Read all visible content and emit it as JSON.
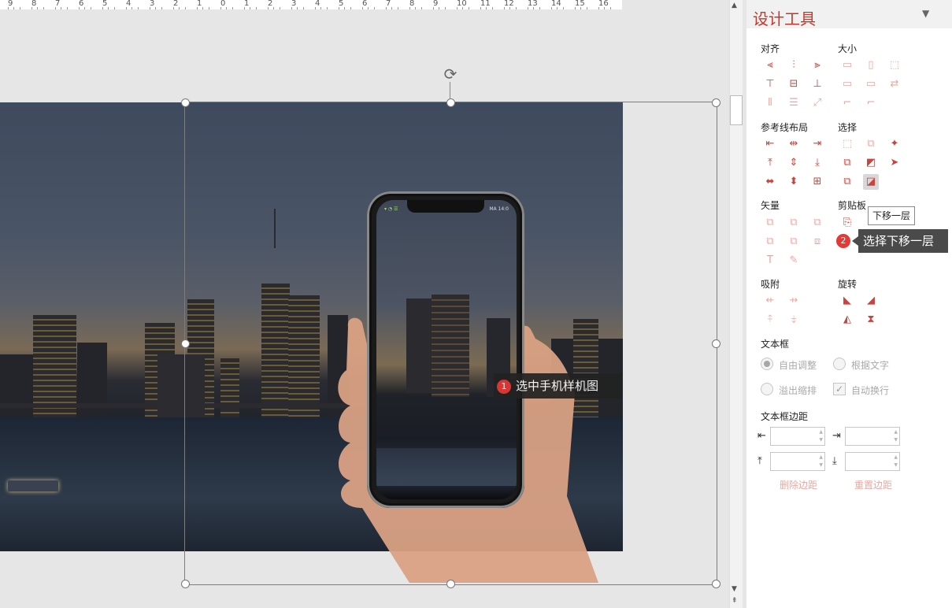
{
  "ruler": {
    "ticks": [
      "9",
      "8",
      "7",
      "6",
      "5",
      "4",
      "3",
      "2",
      "1",
      "0",
      "1",
      "2",
      "3",
      "4",
      "5",
      "6",
      "7",
      "8",
      "9",
      "10",
      "11",
      "12",
      "13",
      "14",
      "15",
      "16"
    ]
  },
  "slide": {
    "callout1": {
      "number": "1",
      "text": "选中手机样机图"
    },
    "phone_status_left": "▾ ◔ ☰",
    "phone_status_right": "MA 14:0"
  },
  "panel": {
    "title": "设计工具",
    "sections": {
      "align": "对齐",
      "size": "大小",
      "guides": "参考线布局",
      "select": "选择",
      "vector": "矢量",
      "clipboard": "剪贴板",
      "snap": "吸附",
      "rotate": "旋转",
      "textbox": "文本框",
      "margins": "文本框边距"
    },
    "tooltip": "下移一层",
    "callout2": {
      "number": "2",
      "text": "选择下移一层"
    },
    "textbox_options": {
      "free_adjust": "自由调整",
      "fit_text": "根据文字",
      "overflow_shrink": "溢出缩排",
      "auto_wrap": "自动换行"
    },
    "margins": {
      "delete": "删除边距",
      "reset": "重置边距",
      "left_value": "",
      "right_value": "",
      "top_value": "",
      "bottom_value": ""
    }
  }
}
